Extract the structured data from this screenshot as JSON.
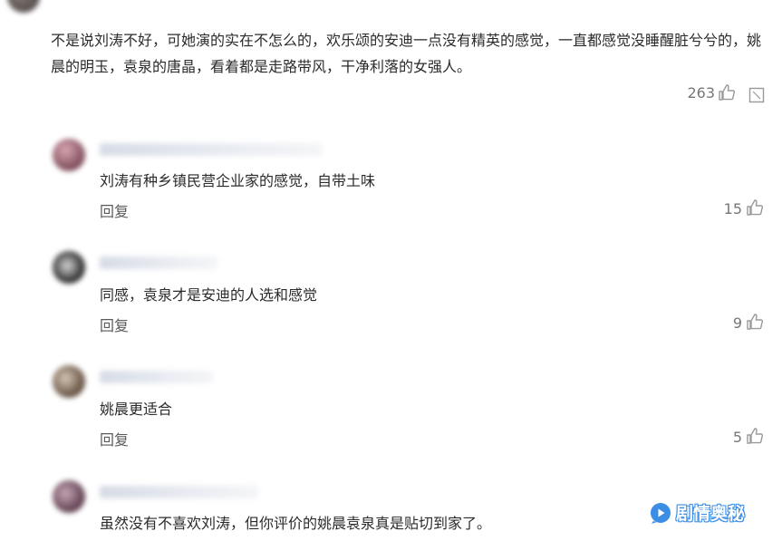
{
  "top_comment": {
    "username": "",
    "text": "不是说刘涛不好，可她演的实在不怎么的，欢乐颂的安迪一点没有精英的感觉，一直都感觉没睡醒脏兮兮的，姚晨的明玉，袁泉的唐晶，看着都是走路带风，干净利落的女强人。",
    "reply_label": "",
    "like_count": "263"
  },
  "replies": [
    {
      "text": "刘涛有种乡镇民营企业家的感觉，自带土味",
      "reply_label": "回复",
      "like_count": "15"
    },
    {
      "text": "同感，袁泉才是安迪的人选和感觉",
      "reply_label": "回复",
      "like_count": "9"
    },
    {
      "text": "姚晨更适合",
      "reply_label": "回复",
      "like_count": "5"
    },
    {
      "text": "虽然没有不喜欢刘涛，但你评价的姚晨袁泉真是贴切到家了。"
    }
  ],
  "watermark": {
    "text": "剧情奥秘",
    "icon": "play-bubble-icon"
  },
  "icons": {
    "like": "thumbs-up-icon",
    "dislike": "thumbs-down-icon"
  },
  "colors": {
    "username": "#6b7aa0",
    "watermark": "#3b8ee6"
  }
}
